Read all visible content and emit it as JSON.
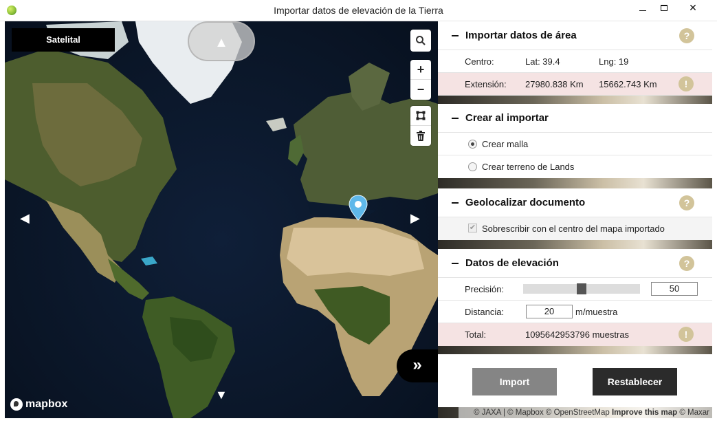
{
  "window": {
    "title": "Importar datos de elevación de la Tierra",
    "min_label": "",
    "close_label": "✕"
  },
  "map": {
    "map_type": "Satelital",
    "north_glyph": "▲",
    "zoom_in": "+",
    "zoom_out": "−",
    "pan_left": "◀",
    "pan_right": "▶",
    "pan_down": "▼",
    "expand_glyph": "»",
    "logo_text": "mapbox",
    "search_icon": "search-icon",
    "draw_icon": "square-draw-icon",
    "trash_icon": "trash-icon",
    "pin_color": "#5fb8ea"
  },
  "sections": {
    "area": {
      "title": "Importar datos de área",
      "help": "?",
      "center_label": "Centro:",
      "lat": "Lat: 39.4",
      "lng": "Lng: 19",
      "extent_label": "Extensión:",
      "extent_x": "27980.838 Km",
      "extent_y": "15662.743 Km",
      "alert": "!"
    },
    "create": {
      "title": "Crear al importar",
      "option_mesh": "Crear malla",
      "option_terrain": "Crear terreno de Lands",
      "selected": "Crear malla"
    },
    "geo": {
      "title": "Geolocalizar documento",
      "help": "?",
      "overwrite": "Sobrescribir con el centro del mapa importado",
      "overwrite_checked": true
    },
    "elevation": {
      "title": "Datos de elevación",
      "help": "?",
      "precision_label": "Precisión:",
      "precision_value": "50",
      "precision_fraction": 0.5,
      "distance_label": "Distancia:",
      "distance_value": "20",
      "distance_unit": "m/muestra",
      "total_label": "Total:",
      "total_value": "1095642953796 muestras",
      "alert": "!"
    }
  },
  "buttons": {
    "import": "Import",
    "reset": "Restablecer"
  },
  "attribution": {
    "text": "© JAXA | © Mapbox © OpenStreetMap ",
    "improve": "Improve this map",
    "tail": " © Maxar"
  },
  "colors": {
    "help_badge": "#d2c49a",
    "warn_row": "#f5e3e3",
    "import_btn": "#858585",
    "reset_btn": "#2b2b2b"
  }
}
